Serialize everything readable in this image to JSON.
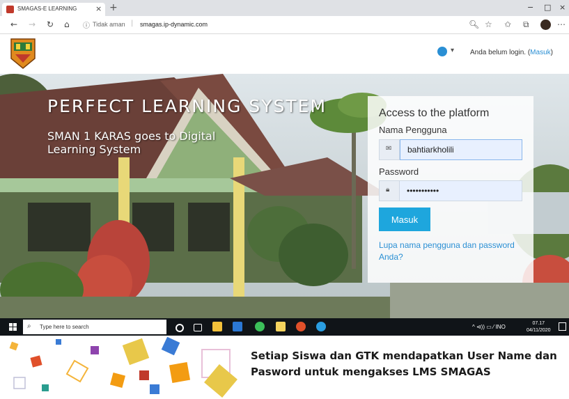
{
  "browser": {
    "tab_title": "SMAGAS-E LEARNING",
    "tab_close": "×",
    "new_tab": "+",
    "window_controls": [
      "−",
      "□",
      "×"
    ],
    "nav_icons": [
      "←",
      "→",
      "↻",
      "⌂"
    ],
    "security_label": "Tidak aman",
    "url": "smagas.ip-dynamic.com",
    "toolbar_icons": [
      "zoom-icon",
      "star-icon",
      "favorites-icon",
      "collections-icon",
      "profile-icon",
      "more-icon"
    ]
  },
  "header": {
    "login_status": "Anda belum login. (",
    "login_link": "Masuk",
    "login_close": ")"
  },
  "hero": {
    "title": "PERFECT LEARNING SYSTEM",
    "subtitle": "SMAN 1 KARAS goes to Digital Learning System"
  },
  "login_form": {
    "title": "Access to the platform",
    "username_label": "Nama Pengguna",
    "username_value": "bahtiarkholili",
    "password_label": "Password",
    "password_value": "•••••••••••",
    "submit_label": "Masuk",
    "forgot_link": "Lupa nama pengguna dan password Anda?"
  },
  "taskbar": {
    "search_placeholder": "Type here to search",
    "tray_text": "^ ⊲)) ▭ ⁄ INO",
    "time": "07.17",
    "date": "04/11/2020"
  },
  "caption": {
    "text": "Setiap Siswa dan GTK mendapatkan User Name dan Pasword untuk mengakses LMS SMAGAS"
  },
  "colors": {
    "accent": "#1ea6dd",
    "link": "#2a8fd4",
    "taskbar": "#101418"
  }
}
